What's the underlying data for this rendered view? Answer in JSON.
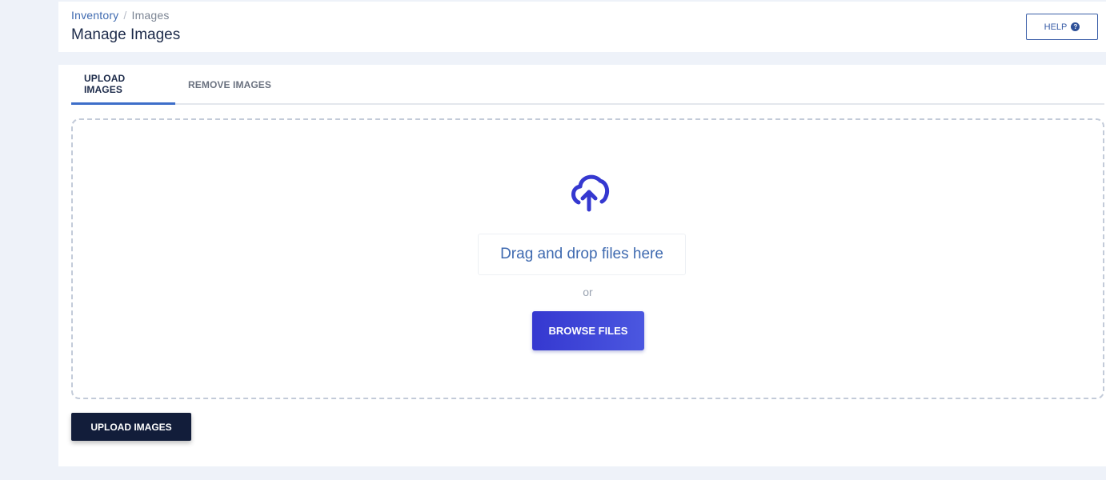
{
  "breadcrumb": {
    "items": [
      "Inventory",
      "Images"
    ],
    "separator": "/"
  },
  "header": {
    "title": "Manage Images",
    "help_label": "HELP",
    "help_icon": "question-circle-icon",
    "help_icon_glyph": "?"
  },
  "tabs": [
    {
      "label": "UPLOAD IMAGES",
      "active": true
    },
    {
      "label": "REMOVE IMAGES",
      "active": false
    }
  ],
  "dropzone": {
    "icon": "cloud-upload-icon",
    "drop_text": "Drag and drop files here",
    "or_text": "or",
    "browse_label": "BROWSE FILES"
  },
  "actions": {
    "upload_label": "UPLOAD IMAGES"
  },
  "colors": {
    "accent": "#3538d0",
    "link": "#3f6ab0",
    "primary_dark": "#121d3a",
    "background": "#eef2f9"
  }
}
